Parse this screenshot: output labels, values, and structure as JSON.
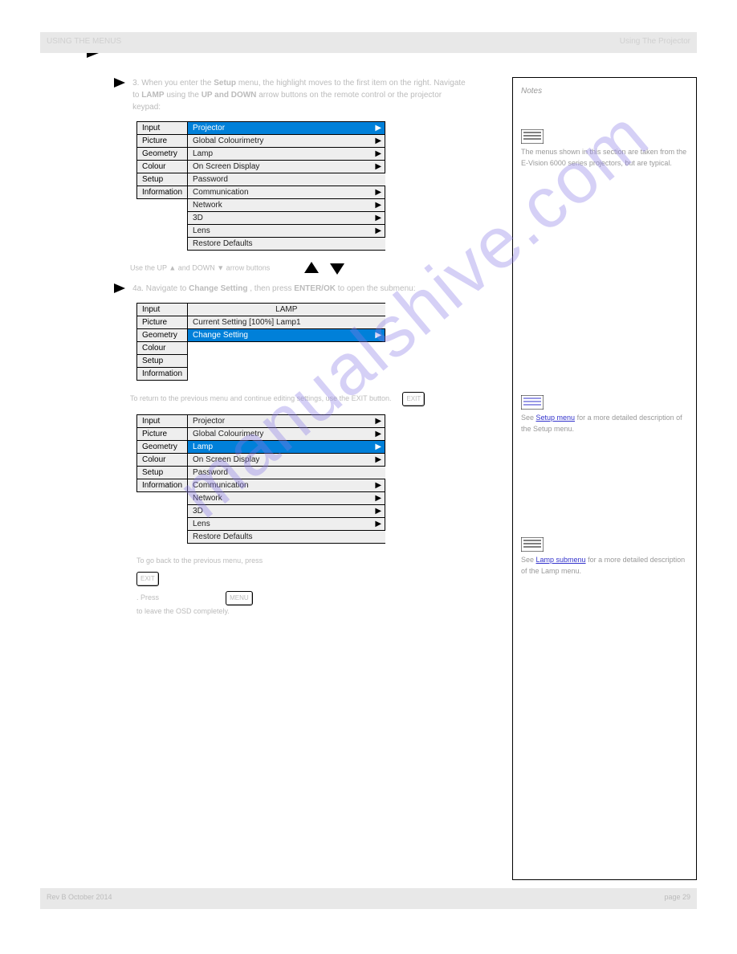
{
  "header": {
    "title_left": "USING THE MENUS",
    "title_right": "Using The Projector"
  },
  "watermark": "manualshive.com",
  "steps": {
    "step3": {
      "label": "3.",
      "text1": "When you enter the ",
      "bold1": "Setup",
      "text2": " menu, the highlight moves to the first item on the right. Navigate to ",
      "bold2": "LAMP",
      "text3": " using the ",
      "arrows": "UP and DOWN",
      "text4": " arrow buttons on the remote control or the projector keypad:",
      "step4": "Use the UP ▲ and DOWN ▼ arrow buttons",
      "step4a_label": "4a.",
      "step4a": "Navigate to ",
      "step4a_bold": "Change Setting",
      "step4a_text2": ", then press ",
      "step4a_enter": "ENTER/OK",
      "step4a_text3": " to open the submenu:",
      "step4b": "To return to the previous menu and continue editing settings, use the EXIT button.",
      "step5_text1": "To go back to the previous menu, press ",
      "step5_key": "EXIT",
      "step5_text2": ". Press ",
      "step5_key2": "MENU",
      "step5_text3": " to leave the OSD completely."
    }
  },
  "menu1": {
    "sidebar": [
      "Input",
      "Picture",
      "Geometry",
      "Colour",
      "Setup",
      "Information"
    ],
    "items": [
      {
        "label": "Projector",
        "sub": true,
        "sel": true
      },
      {
        "label": "Global Colourimetry",
        "sub": true
      },
      {
        "label": "Lamp",
        "sub": true
      },
      {
        "label": "On Screen Display",
        "sub": true
      },
      {
        "label": "Password",
        "sub": false
      },
      {
        "label": "Communication",
        "sub": true
      },
      {
        "label": "Network",
        "sub": true
      },
      {
        "label": "3D",
        "sub": true
      },
      {
        "label": "Lens",
        "sub": true
      },
      {
        "label": "Restore Defaults",
        "sub": false
      }
    ]
  },
  "menu2": {
    "sidebar": [
      "Input",
      "Picture",
      "Geometry",
      "Colour",
      "Setup",
      "Information"
    ],
    "title": "LAMP",
    "items": [
      {
        "label": "Current Setting [100%] Lamp1",
        "sub": false
      },
      {
        "label": "Change Setting",
        "sub": true,
        "sel": true
      }
    ]
  },
  "menu3": {
    "sidebar": [
      "Input",
      "Picture",
      "Geometry",
      "Colour",
      "Setup",
      "Information"
    ],
    "items": [
      {
        "label": "Projector",
        "sub": true
      },
      {
        "label": "Global Colourimetry",
        "sub": true
      },
      {
        "label": "Lamp",
        "sub": true,
        "sel": true
      },
      {
        "label": "On Screen Display",
        "sub": true
      },
      {
        "label": "Password",
        "sub": false
      },
      {
        "label": "Communication",
        "sub": true
      },
      {
        "label": "Network",
        "sub": true
      },
      {
        "label": "3D",
        "sub": true
      },
      {
        "label": "Lens",
        "sub": true
      },
      {
        "label": "Restore Defaults",
        "sub": false
      }
    ]
  },
  "keys": {
    "exit": "EXIT",
    "menu": "MENU"
  },
  "notes": {
    "heading": "Notes",
    "n1": "The menus shown in this section are taken from the E-Vision 6000 series projectors, but are typical.",
    "n2_pre": "See ",
    "n2_link": "Setup menu",
    "n2_post": " for a more detailed description of the Setup menu.",
    "n3_pre": "See ",
    "n3_link": "Lamp submenu",
    "n3_post": " for a more detailed description of the Lamp menu."
  },
  "footer": {
    "left": "Rev B    October 2014",
    "right": "page 29"
  }
}
